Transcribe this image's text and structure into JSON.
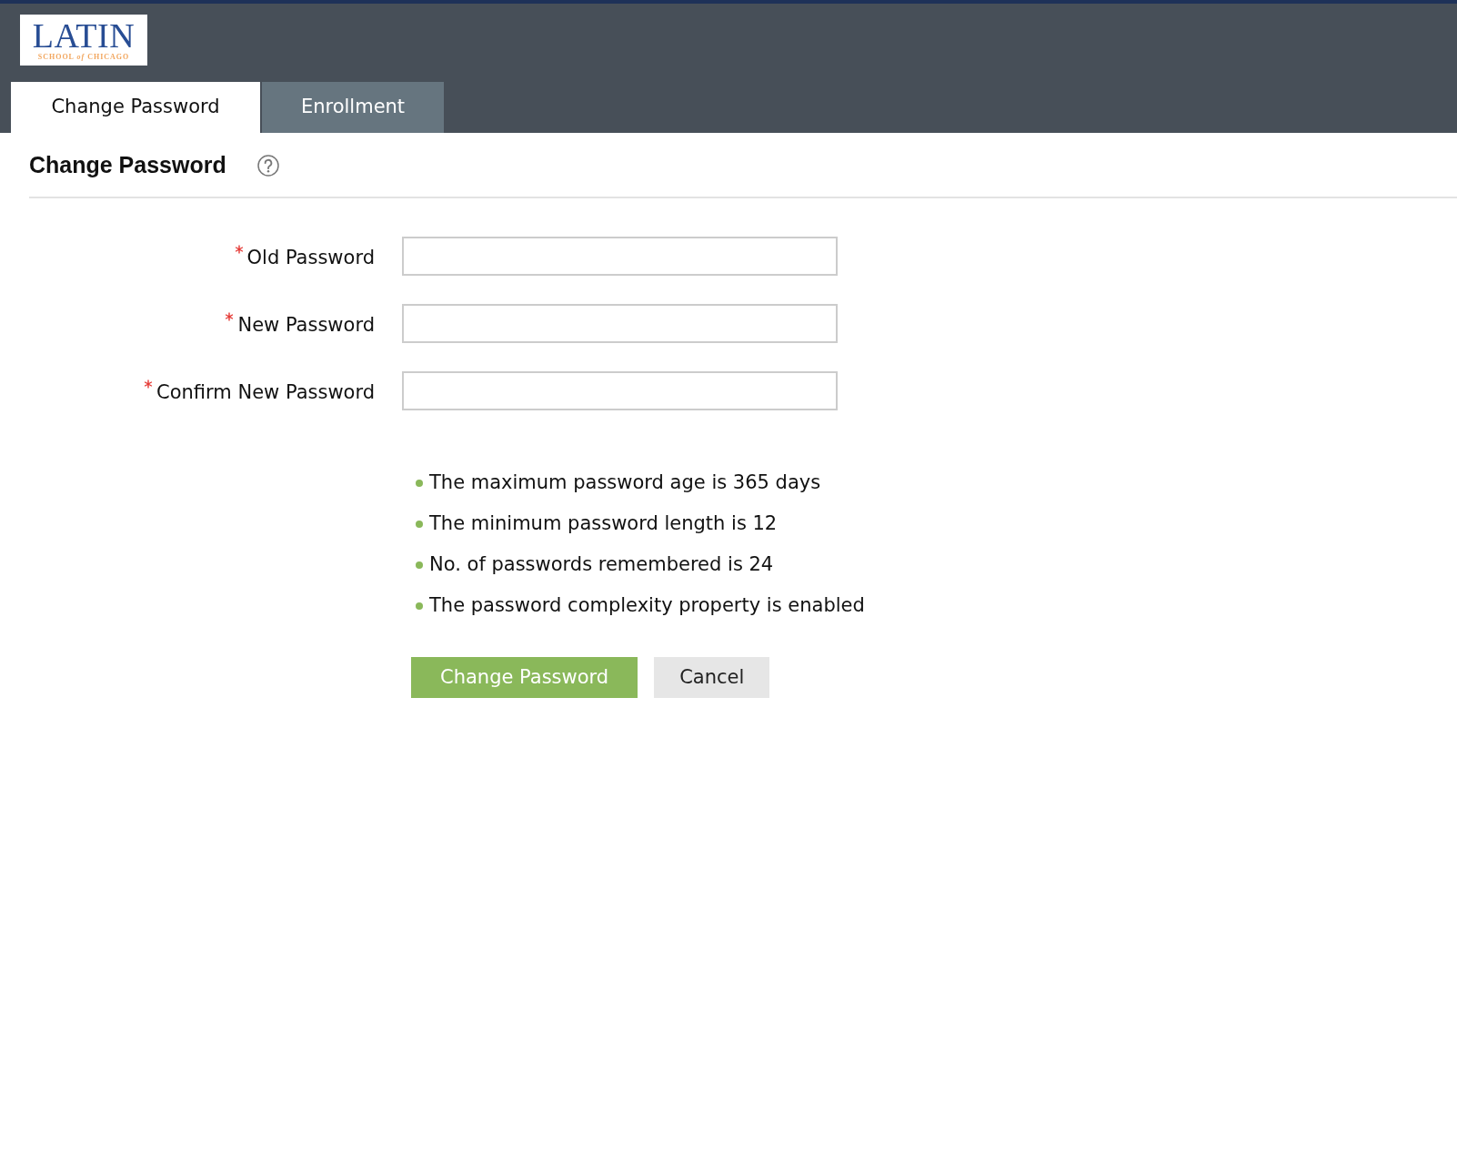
{
  "header": {
    "logo": {
      "title": "LATIN",
      "subtitle": "SCHOOL *of* CHICAGO"
    }
  },
  "tabs": [
    {
      "label": "Change Password",
      "selected": true
    },
    {
      "label": "Enrollment",
      "selected": false
    }
  ],
  "page": {
    "title": "Change Password"
  },
  "form": {
    "fields": [
      {
        "label": "Old Password",
        "required": true
      },
      {
        "label": "New Password",
        "required": true
      },
      {
        "label": "Confirm New Password",
        "required": true
      }
    ]
  },
  "rules": [
    "The maximum password age is 365 days",
    "The minimum password length is 12",
    "No. of passwords remembered is 24",
    "The password complexity property is enabled"
  ],
  "buttons": [
    {
      "label": "Change Password",
      "kind": "primary"
    },
    {
      "label": "Cancel",
      "kind": "secondary"
    }
  ]
}
